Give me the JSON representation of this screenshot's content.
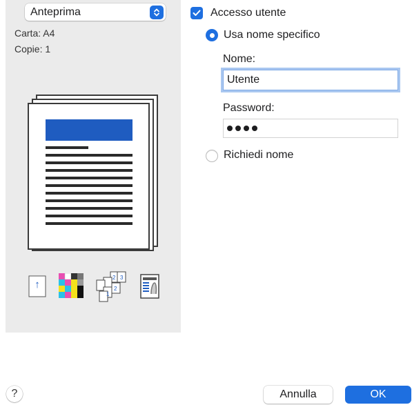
{
  "preview": {
    "preset_label": "Anteprima",
    "paper_label": "Carta: A4",
    "copies_label": "Copie: 1"
  },
  "icons": {
    "stepper": "chevron-updown-icon",
    "orientation": "arrow-up-icon",
    "color": "color-grid-icon",
    "collate": "collate-pages-icon",
    "document": "document-icon"
  },
  "orientation_arrow": "↑",
  "user_access": {
    "checkbox_label": "Accesso utente",
    "checked": true,
    "use_specific_label": "Usa nome specifico",
    "name_label": "Nome:",
    "name_value": "Utente",
    "password_label": "Password:",
    "password_length": 4,
    "ask_name_label": "Richiedi nome"
  },
  "buttons": {
    "help": "?",
    "cancel": "Annulla",
    "ok": "OK"
  },
  "colors": {
    "accent": "#1e6fe0",
    "paper_header": "#1f5cc0"
  }
}
